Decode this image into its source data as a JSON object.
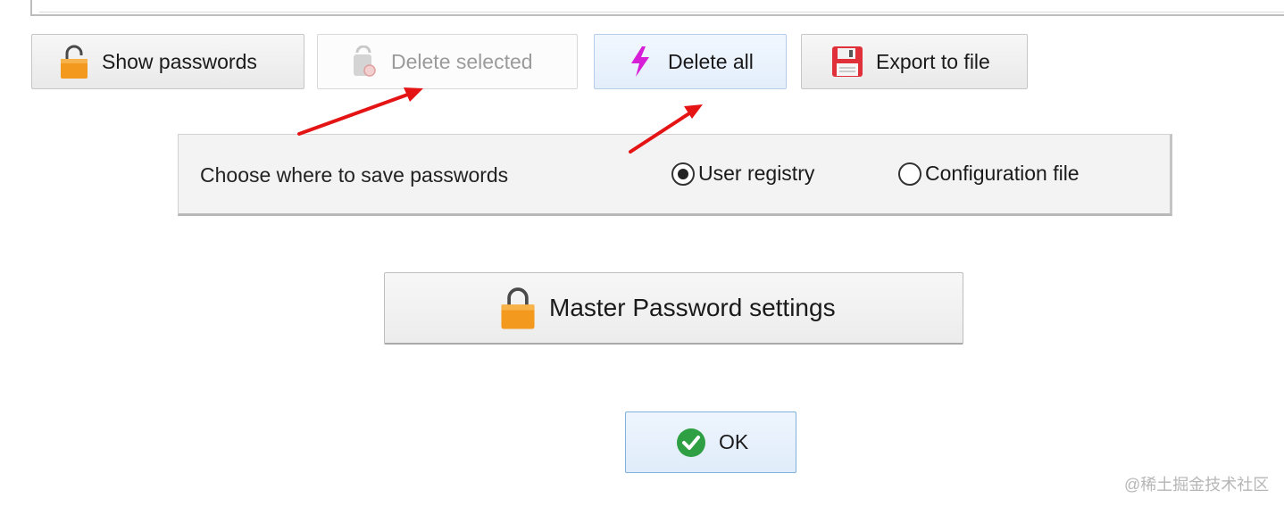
{
  "toolbar": {
    "show_passwords_label": "Show passwords",
    "delete_selected_label": "Delete selected",
    "delete_all_label": "Delete all",
    "export_to_file_label": "Export to file"
  },
  "save_location": {
    "label": "Choose where to save passwords",
    "options": [
      {
        "label": "User registry",
        "selected": true
      },
      {
        "label": "Configuration file",
        "selected": false
      }
    ]
  },
  "master_password": {
    "label": "Master Password settings"
  },
  "ok": {
    "label": "OK"
  },
  "watermark": "@稀土掘金技术社区",
  "icons": {
    "show_passwords": "lock-icon",
    "delete_selected": "trash-icon",
    "delete_all": "lightning-bolt-icon",
    "export_to_file": "floppy-disk-icon",
    "master_password": "lock-icon",
    "ok": "check-circle-icon"
  },
  "colors": {
    "lock_orange": "#f39a1e",
    "bolt_magenta": "#d61fd6",
    "ok_green": "#2ea043",
    "annotation_red": "#e41414",
    "selected_button_border": "#7fb0e0"
  }
}
